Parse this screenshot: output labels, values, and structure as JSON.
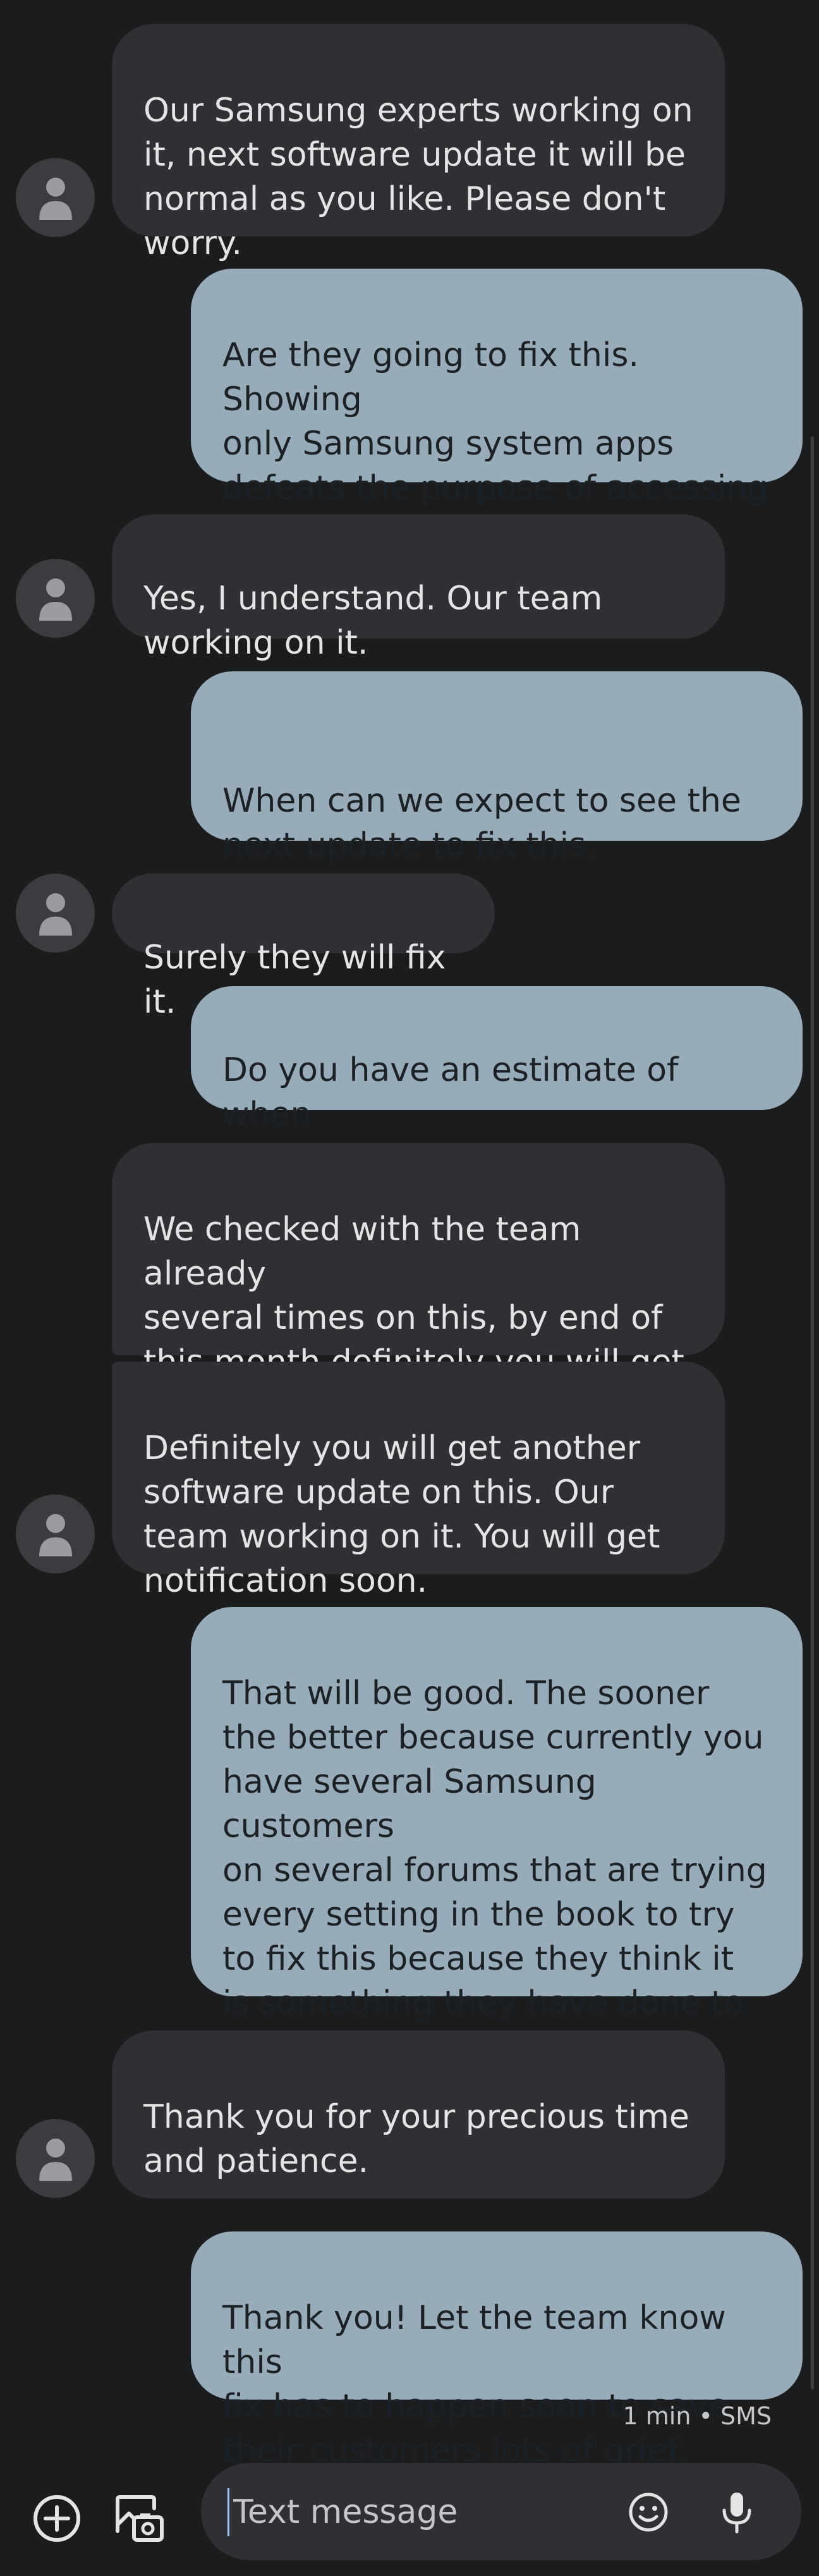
{
  "messages": [
    {
      "text": "Our Samsung experts working on\nit, next software update it will be\nnormal as you like. Please don't\nworry."
    },
    {
      "text": "Are they going to fix this. Showing\nonly Samsung system apps\ndefeats the purpose of accessing\nthe recent apps list."
    },
    {
      "text": "Yes, I understand. Our team\nworking on it."
    },
    {
      "text": "When can we expect to see the\nnext update to fix this."
    },
    {
      "text": "Surely they will fix it."
    },
    {
      "text": "Do you have an estimate of when\nthat will be?"
    },
    {
      "text": "We checked with the team already\nseveral times on this, by end of\nthis month definitely you will get\nanother software update on this."
    },
    {
      "text": "Definitely you will get another\nsoftware update on this. Our\nteam working on it. You will get\nnotification soon."
    },
    {
      "text": "That will be good. The sooner\nthe better because currently you\nhave several Samsung customers\non several forums that are trying\nevery setting in the book to try\nto fix this because they think it\nis something they have done to\nchange it."
    },
    {
      "text": "Thank you for your precious time\nand patience."
    },
    {
      "text": "Thank you! Let the team know this\nfix has to happen soon to save\ntheir customers lots of grief."
    }
  ],
  "last_message_meta": "1 min • SMS",
  "composer": {
    "placeholder": "Text message"
  },
  "colors": {
    "incoming_bubble": "#2e3033",
    "outgoing_bubble": "#98abb9",
    "background": "#1b1c1e"
  }
}
